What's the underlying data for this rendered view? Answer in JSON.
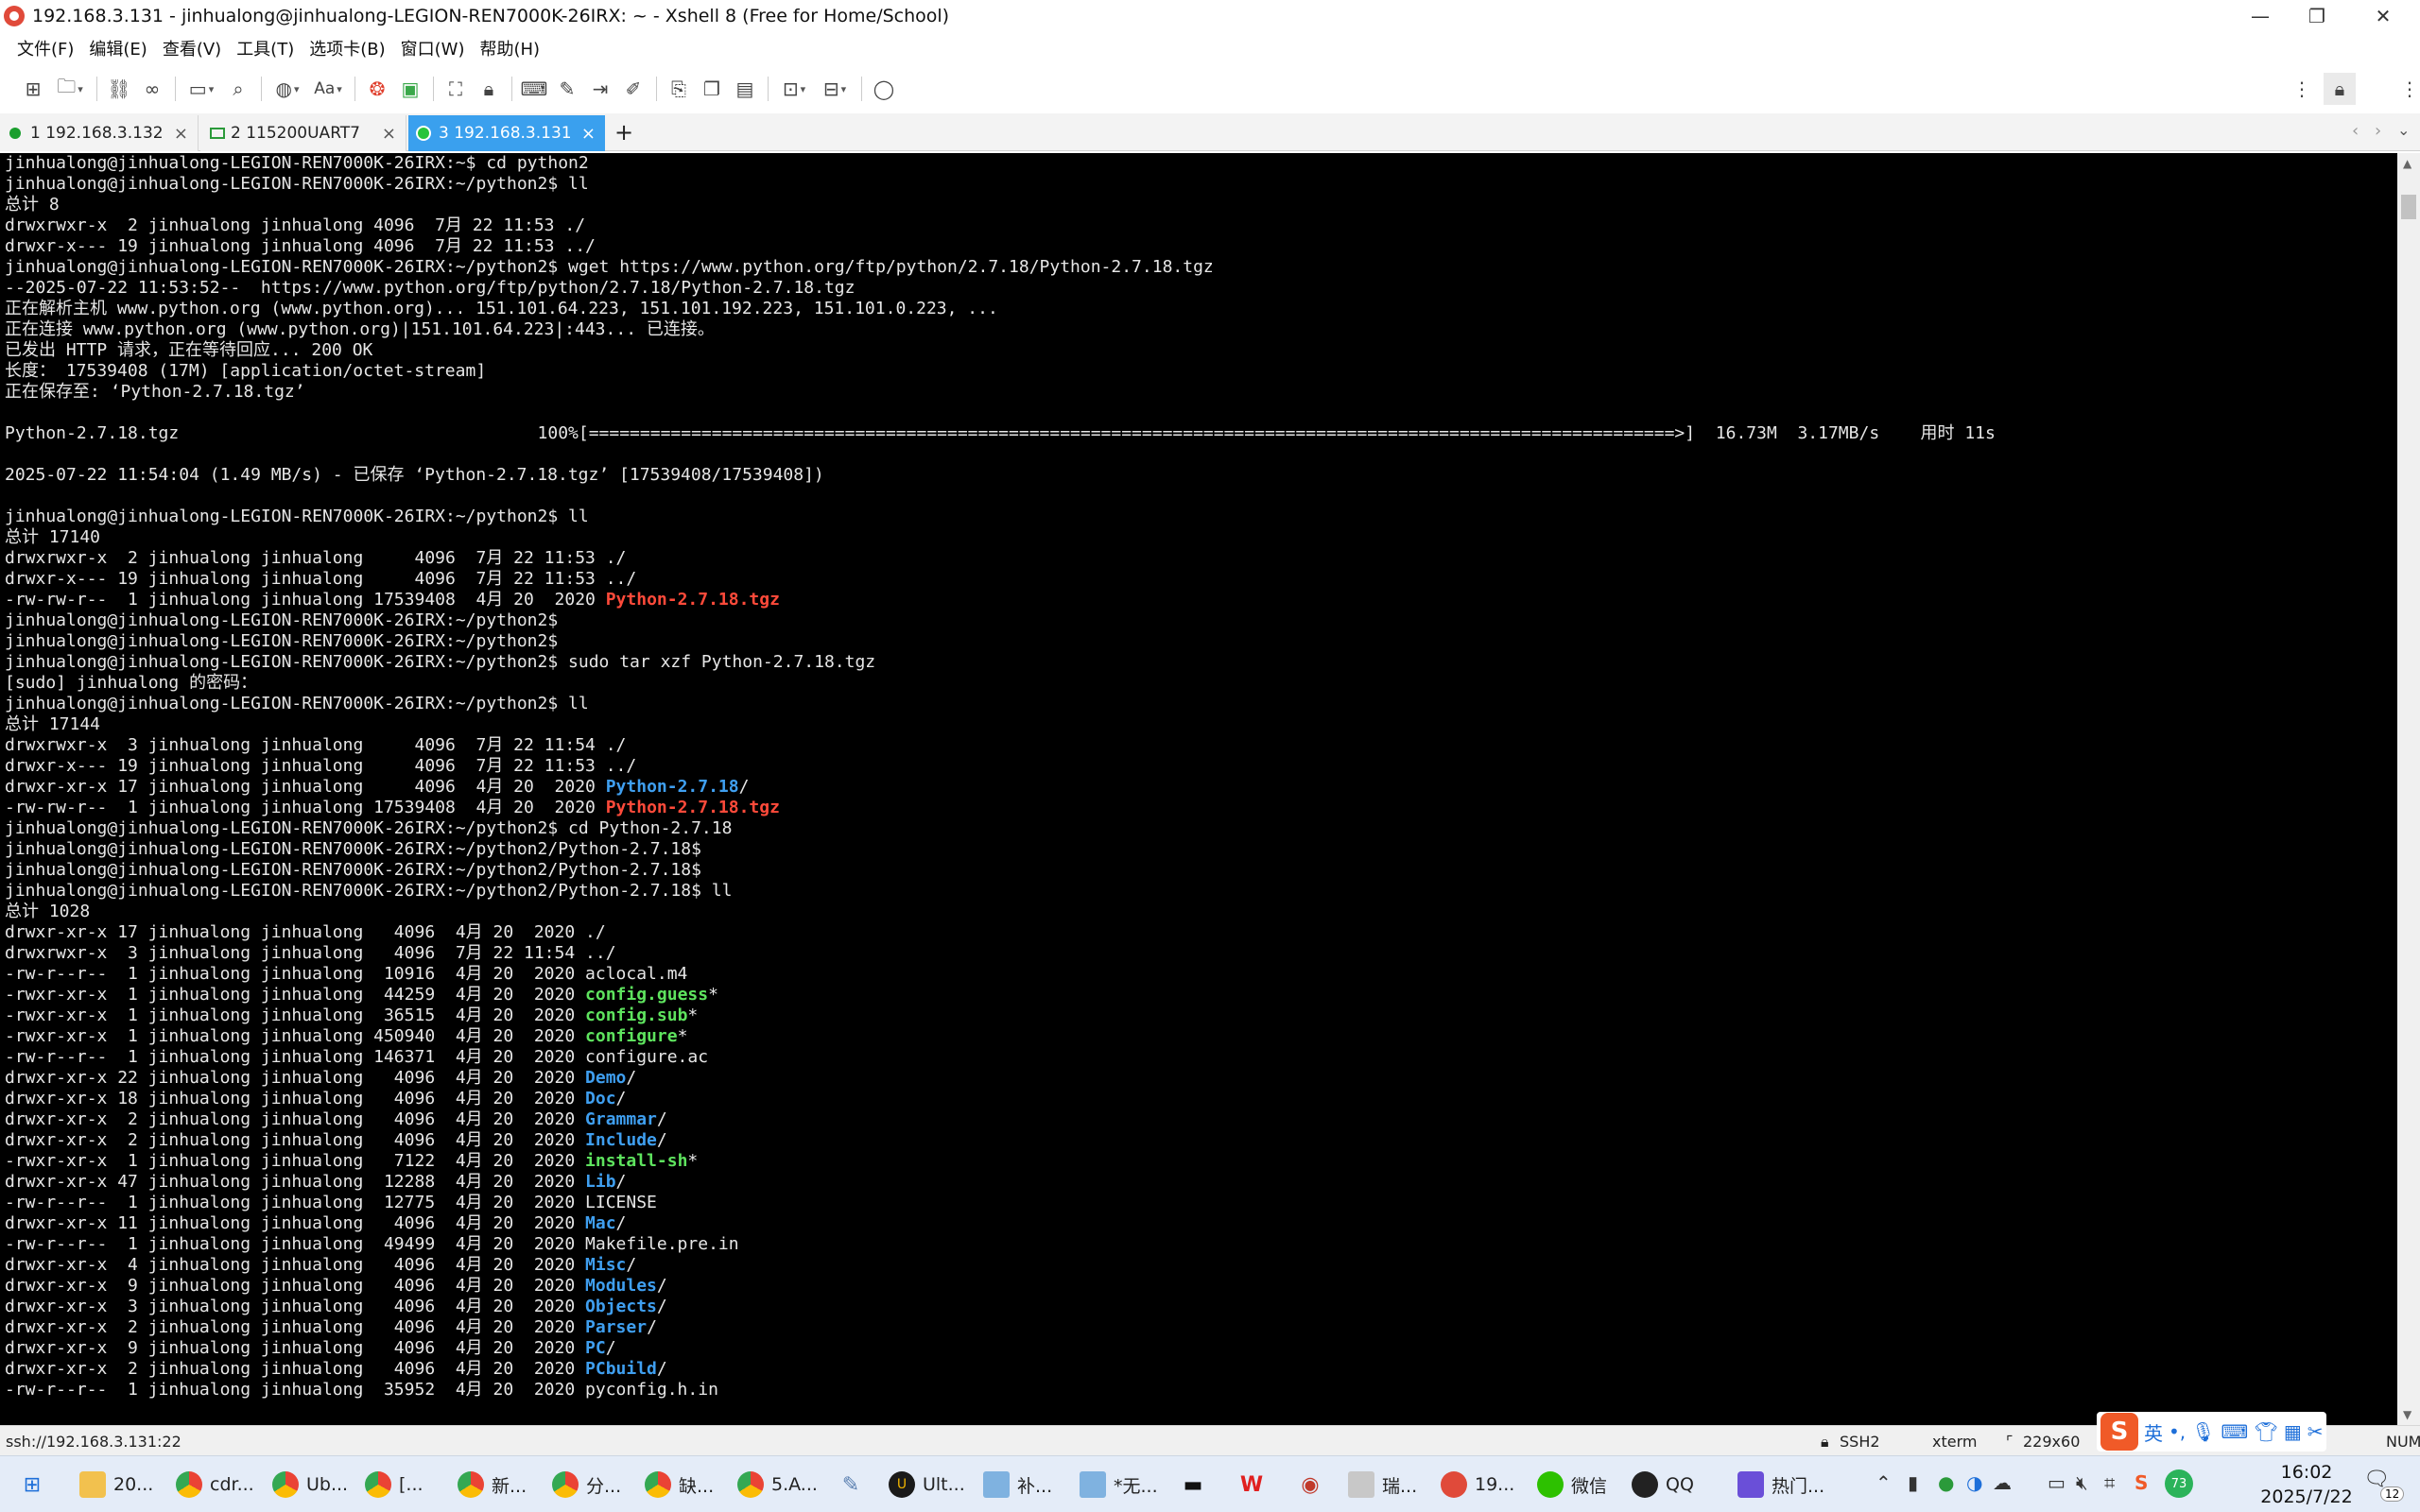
{
  "window": {
    "title": "192.168.3.131 - jinhualong@jinhualong-LEGION-REN7000K-26IRX: ~ - Xshell 8 (Free for Home/School)",
    "minimize": "—",
    "restore": "❐",
    "close": "✕"
  },
  "menu": [
    "文件(F)",
    "编辑(E)",
    "查看(V)",
    "工具(T)",
    "选项卡(B)",
    "窗口(W)",
    "帮助(H)"
  ],
  "toolbar_icons": [
    "new-session-icon",
    "open-folder-icon",
    "link-icon",
    "unlink-icon",
    "new-window-icon",
    "search-icon",
    "globe-icon",
    "font-icon",
    "xftp-icon",
    "xmanager-icon",
    "fullscreen-icon",
    "lock-icon",
    "keyboard-icon",
    "script-icon",
    "transfer-icon",
    "highlight-icon",
    "log-icon",
    "copy-icon",
    "paste-icon",
    "layout-icon",
    "split-icon",
    "chat-icon"
  ],
  "tabs": [
    {
      "label": "1 192.168.3.132",
      "icon": "green-dot"
    },
    {
      "label": "2 115200UART7",
      "icon": "serial-icon"
    },
    {
      "label": "3 192.168.3.131",
      "icon": "green-dot"
    }
  ],
  "add_tab": "+",
  "terminal": {
    "lines": [
      [
        {
          "t": "jinhualong@jinhualong-LEGION-REN7000K-26IRX:~$ cd python2"
        }
      ],
      [
        {
          "t": "jinhualong@jinhualong-LEGION-REN7000K-26IRX:~/python2$ ll"
        }
      ],
      [
        {
          "t": "总计 8"
        }
      ],
      [
        {
          "t": "drwxrwxr-x  2 jinhualong jinhualong 4096  7月 22 11:53 ./"
        }
      ],
      [
        {
          "t": "drwxr-x--- 19 jinhualong jinhualong 4096  7月 22 11:53 ../"
        }
      ],
      [
        {
          "t": "jinhualong@jinhualong-LEGION-REN7000K-26IRX:~/python2$ wget https://www.python.org/ftp/python/2.7.18/Python-2.7.18.tgz"
        }
      ],
      [
        {
          "t": "--2025-07-22 11:53:52--  https://www.python.org/ftp/python/2.7.18/Python-2.7.18.tgz"
        }
      ],
      [
        {
          "t": "正在解析主机 www.python.org (www.python.org)... 151.101.64.223, 151.101.192.223, 151.101.0.223, ..."
        }
      ],
      [
        {
          "t": "正在连接 www.python.org (www.python.org)|151.101.64.223|:443... 已连接。"
        }
      ],
      [
        {
          "t": "已发出 HTTP 请求，正在等待回应... 200 OK"
        }
      ],
      [
        {
          "t": "长度： 17539408 (17M) [application/octet-stream]"
        }
      ],
      [
        {
          "t": "正在保存至: ‘Python-2.7.18.tgz’"
        }
      ],
      [
        {
          "t": ""
        }
      ],
      [
        {
          "t": "Python-2.7.18.tgz                                   100%[==========================================================================================================>]  16.73M  3.17MB/s    用时 11s"
        }
      ],
      [
        {
          "t": ""
        }
      ],
      [
        {
          "t": "2025-07-22 11:54:04 (1.49 MB/s) - 已保存 ‘Python-2.7.18.tgz’ [17539408/17539408])"
        }
      ],
      [
        {
          "t": ""
        }
      ],
      [
        {
          "t": "jinhualong@jinhualong-LEGION-REN7000K-26IRX:~/python2$ ll"
        }
      ],
      [
        {
          "t": "总计 17140"
        }
      ],
      [
        {
          "t": "drwxrwxr-x  2 jinhualong jinhualong     4096  7月 22 11:53 ./"
        }
      ],
      [
        {
          "t": "drwxr-x--- 19 jinhualong jinhualong     4096  7月 22 11:53 ../"
        }
      ],
      [
        {
          "t": "-rw-rw-r--  1 jinhualong jinhualong 17539408  4月 20  2020 "
        },
        {
          "t": "Python-2.7.18.tgz",
          "c": "red"
        }
      ],
      [
        {
          "t": "jinhualong@jinhualong-LEGION-REN7000K-26IRX:~/python2$"
        }
      ],
      [
        {
          "t": "jinhualong@jinhualong-LEGION-REN7000K-26IRX:~/python2$"
        }
      ],
      [
        {
          "t": "jinhualong@jinhualong-LEGION-REN7000K-26IRX:~/python2$ sudo tar xzf Python-2.7.18.tgz"
        }
      ],
      [
        {
          "t": "[sudo] jinhualong 的密码："
        }
      ],
      [
        {
          "t": "jinhualong@jinhualong-LEGION-REN7000K-26IRX:~/python2$ ll"
        }
      ],
      [
        {
          "t": "总计 17144"
        }
      ],
      [
        {
          "t": "drwxrwxr-x  3 jinhualong jinhualong     4096  7月 22 11:54 ./"
        }
      ],
      [
        {
          "t": "drwxr-x--- 19 jinhualong jinhualong     4096  7月 22 11:53 ../"
        }
      ],
      [
        {
          "t": "drwxr-xr-x 17 jinhualong jinhualong     4096  4月 20  2020 "
        },
        {
          "t": "Python-2.7.18",
          "c": "blue"
        },
        {
          "t": "/"
        }
      ],
      [
        {
          "t": "-rw-rw-r--  1 jinhualong jinhualong 17539408  4月 20  2020 "
        },
        {
          "t": "Python-2.7.18.tgz",
          "c": "red"
        }
      ],
      [
        {
          "t": "jinhualong@jinhualong-LEGION-REN7000K-26IRX:~/python2$ cd Python-2.7.18"
        }
      ],
      [
        {
          "t": "jinhualong@jinhualong-LEGION-REN7000K-26IRX:~/python2/Python-2.7.18$"
        }
      ],
      [
        {
          "t": "jinhualong@jinhualong-LEGION-REN7000K-26IRX:~/python2/Python-2.7.18$"
        }
      ],
      [
        {
          "t": "jinhualong@jinhualong-LEGION-REN7000K-26IRX:~/python2/Python-2.7.18$ ll"
        }
      ],
      [
        {
          "t": "总计 1028"
        }
      ],
      [
        {
          "t": "drwxr-xr-x 17 jinhualong jinhualong   4096  4月 20  2020 ./"
        }
      ],
      [
        {
          "t": "drwxrwxr-x  3 jinhualong jinhualong   4096  7月 22 11:54 ../"
        }
      ],
      [
        {
          "t": "-rw-r--r--  1 jinhualong jinhualong  10916  4月 20  2020 aclocal.m4"
        }
      ],
      [
        {
          "t": "-rwxr-xr-x  1 jinhualong jinhualong  44259  4月 20  2020 "
        },
        {
          "t": "config.guess",
          "c": "green"
        },
        {
          "t": "*"
        }
      ],
      [
        {
          "t": "-rwxr-xr-x  1 jinhualong jinhualong  36515  4月 20  2020 "
        },
        {
          "t": "config.sub",
          "c": "green"
        },
        {
          "t": "*"
        }
      ],
      [
        {
          "t": "-rwxr-xr-x  1 jinhualong jinhualong 450940  4月 20  2020 "
        },
        {
          "t": "configure",
          "c": "green"
        },
        {
          "t": "*"
        }
      ],
      [
        {
          "t": "-rw-r--r--  1 jinhualong jinhualong 146371  4月 20  2020 configure.ac"
        }
      ],
      [
        {
          "t": "drwxr-xr-x 22 jinhualong jinhualong   4096  4月 20  2020 "
        },
        {
          "t": "Demo",
          "c": "blue"
        },
        {
          "t": "/"
        }
      ],
      [
        {
          "t": "drwxr-xr-x 18 jinhualong jinhualong   4096  4月 20  2020 "
        },
        {
          "t": "Doc",
          "c": "blue"
        },
        {
          "t": "/"
        }
      ],
      [
        {
          "t": "drwxr-xr-x  2 jinhualong jinhualong   4096  4月 20  2020 "
        },
        {
          "t": "Grammar",
          "c": "blue"
        },
        {
          "t": "/"
        }
      ],
      [
        {
          "t": "drwxr-xr-x  2 jinhualong jinhualong   4096  4月 20  2020 "
        },
        {
          "t": "Include",
          "c": "blue"
        },
        {
          "t": "/"
        }
      ],
      [
        {
          "t": "-rwxr-xr-x  1 jinhualong jinhualong   7122  4月 20  2020 "
        },
        {
          "t": "install-sh",
          "c": "green"
        },
        {
          "t": "*"
        }
      ],
      [
        {
          "t": "drwxr-xr-x 47 jinhualong jinhualong  12288  4月 20  2020 "
        },
        {
          "t": "Lib",
          "c": "blue"
        },
        {
          "t": "/"
        }
      ],
      [
        {
          "t": "-rw-r--r--  1 jinhualong jinhualong  12775  4月 20  2020 LICENSE"
        }
      ],
      [
        {
          "t": "drwxr-xr-x 11 jinhualong jinhualong   4096  4月 20  2020 "
        },
        {
          "t": "Mac",
          "c": "blue"
        },
        {
          "t": "/"
        }
      ],
      [
        {
          "t": "-rw-r--r--  1 jinhualong jinhualong  49499  4月 20  2020 Makefile.pre.in"
        }
      ],
      [
        {
          "t": "drwxr-xr-x  4 jinhualong jinhualong   4096  4月 20  2020 "
        },
        {
          "t": "Misc",
          "c": "blue"
        },
        {
          "t": "/"
        }
      ],
      [
        {
          "t": "drwxr-xr-x  9 jinhualong jinhualong   4096  4月 20  2020 "
        },
        {
          "t": "Modules",
          "c": "blue"
        },
        {
          "t": "/"
        }
      ],
      [
        {
          "t": "drwxr-xr-x  3 jinhualong jinhualong   4096  4月 20  2020 "
        },
        {
          "t": "Objects",
          "c": "blue"
        },
        {
          "t": "/"
        }
      ],
      [
        {
          "t": "drwxr-xr-x  2 jinhualong jinhualong   4096  4月 20  2020 "
        },
        {
          "t": "Parser",
          "c": "blue"
        },
        {
          "t": "/"
        }
      ],
      [
        {
          "t": "drwxr-xr-x  9 jinhualong jinhualong   4096  4月 20  2020 "
        },
        {
          "t": "PC",
          "c": "blue"
        },
        {
          "t": "/"
        }
      ],
      [
        {
          "t": "drwxr-xr-x  2 jinhualong jinhualong   4096  4月 20  2020 "
        },
        {
          "t": "PCbuild",
          "c": "blue"
        },
        {
          "t": "/"
        }
      ],
      [
        {
          "t": "-rw-r--r--  1 jinhualong jinhualong  35952  4月 20  2020 pyconfig.h.in"
        }
      ]
    ]
  },
  "status": {
    "connection": "ssh://192.168.3.131:22",
    "protocol": "SSH2",
    "term": "xterm",
    "size": "229x60",
    "num": "NUM"
  },
  "taskbar": {
    "items": [
      "20...",
      "cdr...",
      "Ub...",
      "[...",
      "新...",
      "分...",
      "缺...",
      "5.A...",
      "Ult...",
      "补...",
      "*无...",
      "瑞...",
      "19...",
      "微信",
      "QQ",
      "热门..."
    ],
    "time": "16:02",
    "date": "2025/7/22",
    "notifications": "12",
    "ime_lang": "英",
    "badge": "73"
  },
  "colors": {
    "active_tab": "#3aa0ee",
    "terminal_bg": "#000000",
    "dir_blue": "#3f9ff0",
    "exec_green": "#5ee35e",
    "archive_red": "#ff4a3a"
  }
}
